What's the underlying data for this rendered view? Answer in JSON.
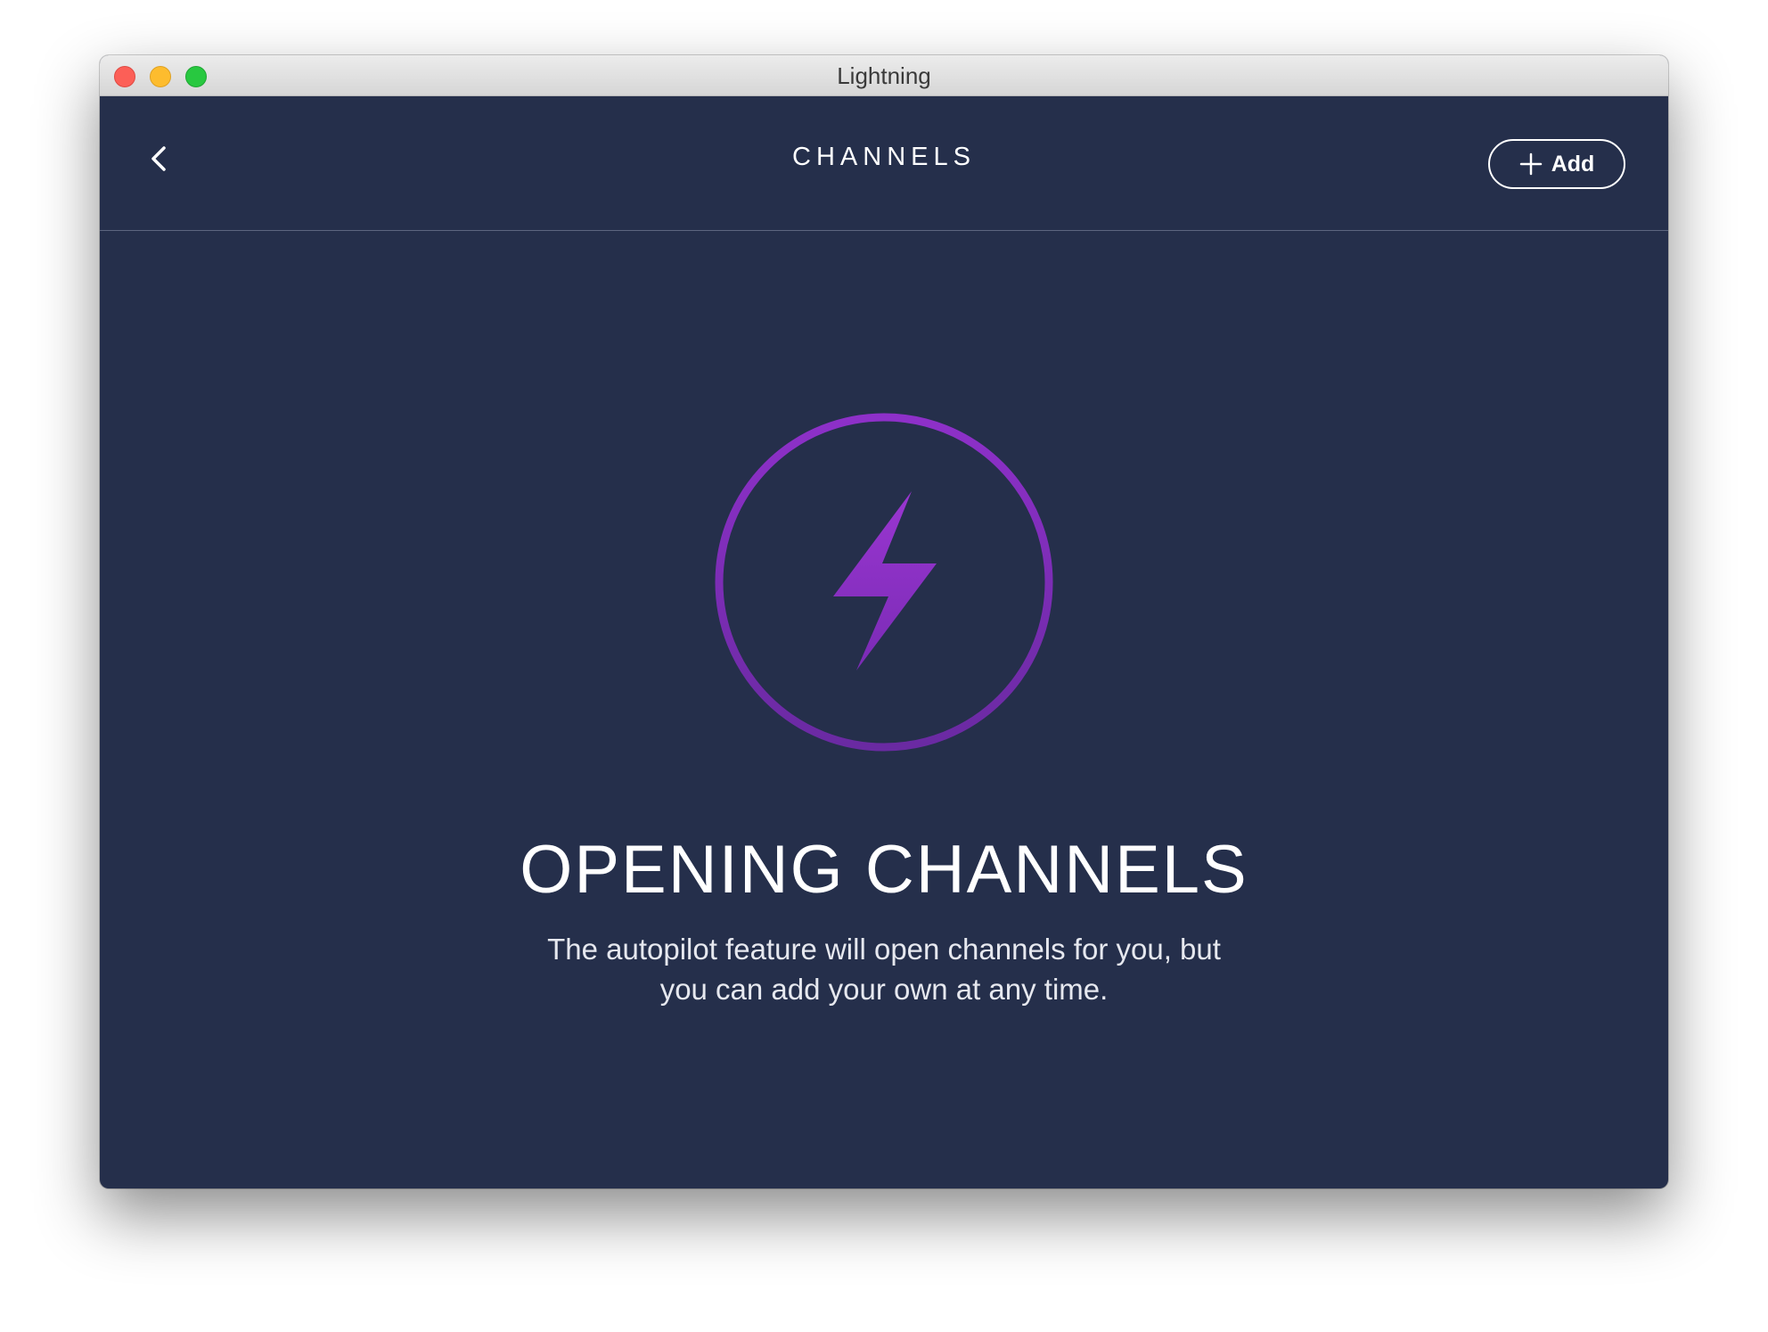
{
  "window": {
    "title": "Lightning"
  },
  "header": {
    "title": "CHANNELS",
    "add_label": "Add"
  },
  "empty_state": {
    "heading": "OPENING CHANNELS",
    "description": "The autopilot feature will open channels for you, but you can add your own at any time."
  },
  "colors": {
    "background": "#252f4b",
    "accent_purple": "#8e30c9",
    "accent_purple_dark": "#6a2aa2",
    "text": "#ffffff"
  },
  "icons": {
    "back": "chevron-left-icon",
    "add": "plus-icon",
    "hero": "lightning-bolt-icon"
  }
}
